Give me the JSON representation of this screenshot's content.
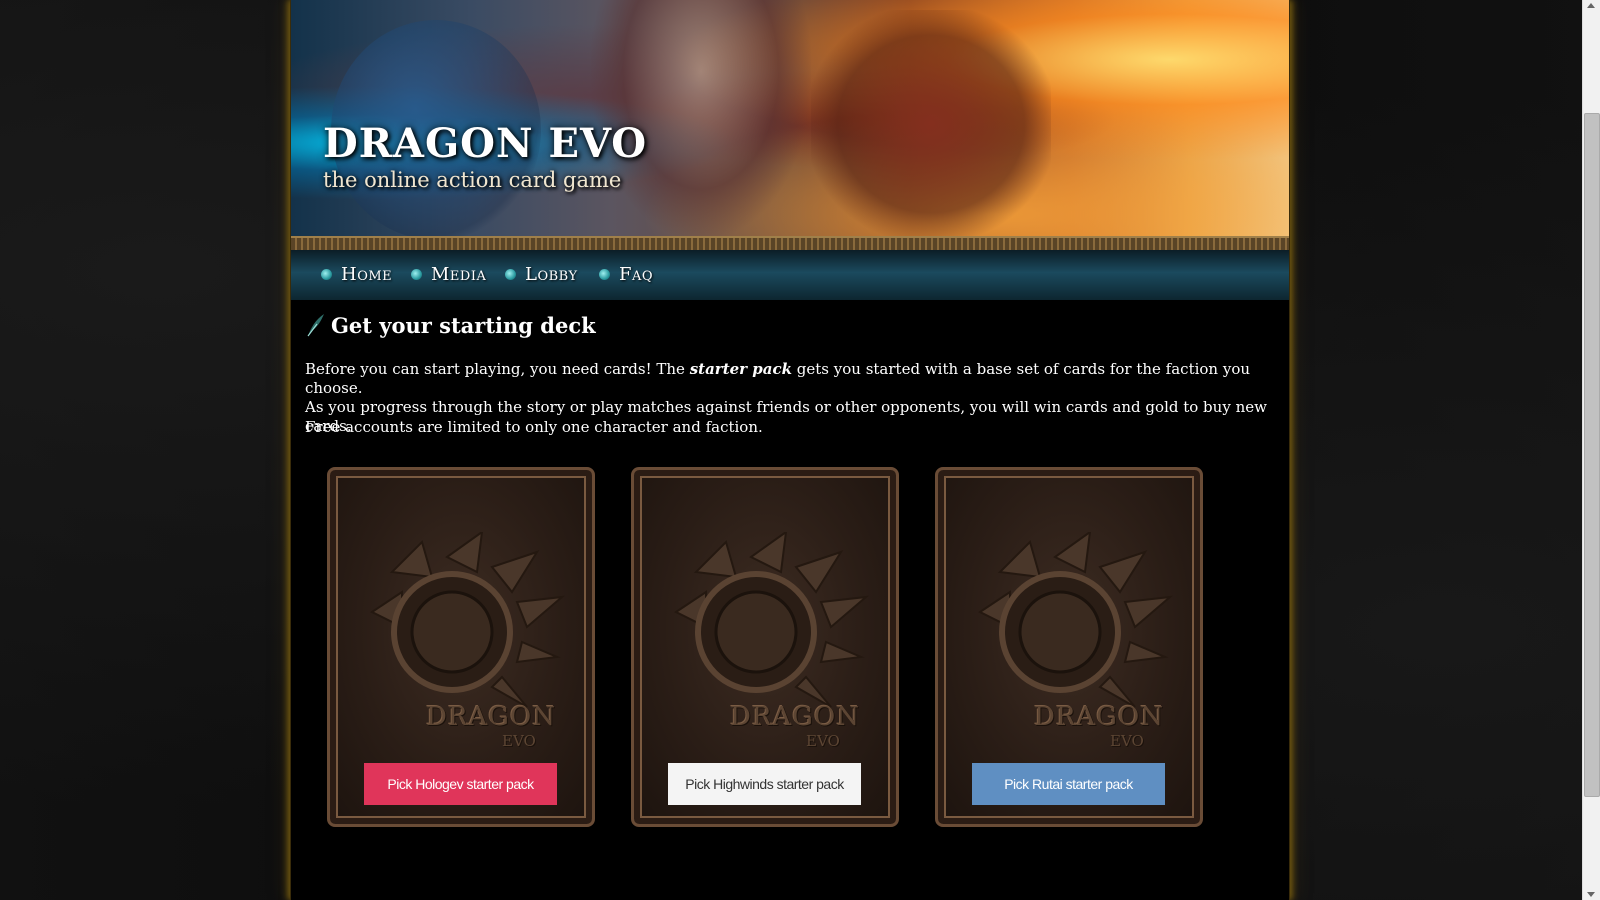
{
  "header": {
    "logo_title": "DRAGON EVO",
    "logo_subtitle": "the online action card game"
  },
  "nav": {
    "items": [
      {
        "label": "Home"
      },
      {
        "label": "Media"
      },
      {
        "label": "Lobby"
      },
      {
        "label": "Faq"
      }
    ]
  },
  "main": {
    "heading": "Get your starting deck",
    "intro_line1_before": "Before you can start playing, you need cards! The ",
    "intro_line1_emphasis": "starter pack",
    "intro_line1_after": " gets you started with a base set of cards for the faction you choose.",
    "intro_line2": "As you progress through the story or play matches against friends or other opponents, you will win cards and gold to buy new cards.",
    "limit_note": "Free accounts are limited to only one character and faction."
  },
  "cards": [
    {
      "brand": "DRAGON",
      "brand_sub": "EVO",
      "button_label": "Pick Hologev starter pack",
      "button_color": "#e0355a",
      "button_text_color": "#ffffff"
    },
    {
      "brand": "DRAGON",
      "brand_sub": "EVO",
      "button_label": "Pick Highwinds starter pack",
      "button_color": "#f4f4f4",
      "button_text_color": "#333333"
    },
    {
      "brand": "DRAGON",
      "brand_sub": "EVO",
      "button_label": "Pick Rutai starter pack",
      "button_color": "#5f8fc2",
      "button_text_color": "#ffffff"
    }
  ],
  "colors": {
    "page_background": "#000000",
    "frame_glow": "#6b5410",
    "nav_bullet": "#2a9aa0"
  }
}
